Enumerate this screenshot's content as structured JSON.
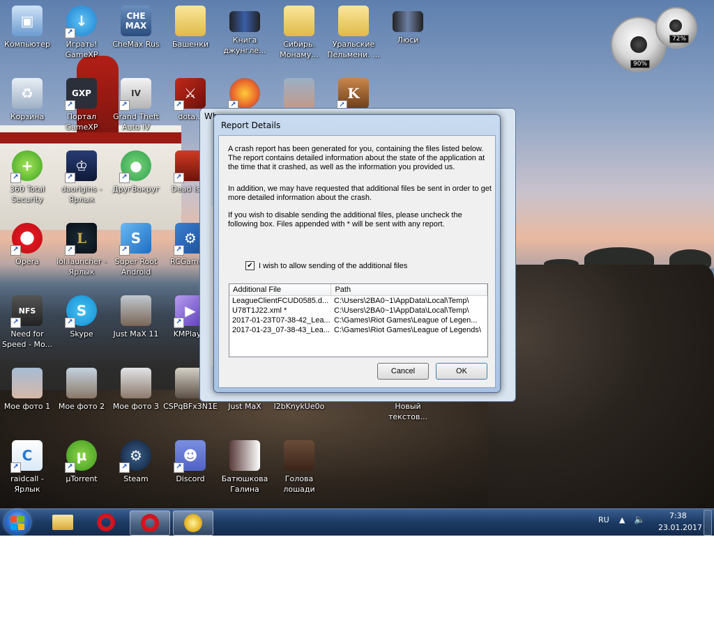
{
  "desktop": {
    "icons": [
      {
        "label": "Компьютер"
      },
      {
        "label": "Играть! GameXP"
      },
      {
        "label": "CheMax Rus"
      },
      {
        "label": "Башенки"
      },
      {
        "label": "Книга джунгле..."
      },
      {
        "label": "Сибирь. Монаму..."
      },
      {
        "label": "Уральские Пельмени. ..."
      },
      {
        "label": "Люси"
      },
      {
        "label": "Корзина"
      },
      {
        "label": "Портал GameXP"
      },
      {
        "label": "Grand Theft Auto IV"
      },
      {
        "label": "dota..."
      },
      {
        "label": "360 Total Security"
      },
      {
        "label": "daorigins - Ярлык"
      },
      {
        "label": "ДругВокруг"
      },
      {
        "label": "Dead Isl..."
      },
      {
        "label": "Opera"
      },
      {
        "label": "lol.launcher - Ярлык"
      },
      {
        "label": "Super Root Android"
      },
      {
        "label": "RCGame..."
      },
      {
        "label": "Need for Speed - Mo..."
      },
      {
        "label": "Skype"
      },
      {
        "label": "Just MaX 11"
      },
      {
        "label": "KMPlay..."
      },
      {
        "label": "Мое фото 1"
      },
      {
        "label": "Мое фото 2"
      },
      {
        "label": "Мое фото 3"
      },
      {
        "label": "CSPqBFx3N1E"
      },
      {
        "label": "Just MaX"
      },
      {
        "label": "l2bKnykUe0o"
      },
      {
        "label": "Новый текстов..."
      },
      {
        "label": "raidcall - Ярлык"
      },
      {
        "label": "µTorrent"
      },
      {
        "label": "Steam"
      },
      {
        "label": "Discord"
      },
      {
        "label": "Батюшкова Галина"
      },
      {
        "label": "Голова лошади"
      }
    ]
  },
  "gadget": {
    "cpu": "90%",
    "memory": "72%"
  },
  "background_window": {
    "title": "Wh..."
  },
  "dialog": {
    "title": "Report Details",
    "paragraph1": "A crash report has been generated for you, containing the files listed below. The report contains detailed information about the state of the application at the time that it crashed, as well as the information you provided us.",
    "paragraph2": "In addition, we may have requested that additional files be sent in order to get more detailed information about the crash.",
    "paragraph3": "If you wish to disable sending the additional files, please uncheck the following box.  Files appended with * will be sent with any report.",
    "checkbox_label": "I wish to allow sending of the additional files",
    "checkbox_checked": true,
    "columns": [
      "Additional File",
      "Path"
    ],
    "rows": [
      {
        "file": "LeagueClientFCUD0585.d...",
        "path": "C:\\Users\\2BA0~1\\AppData\\Local\\Temp\\"
      },
      {
        "file": "U78T1J22.xml *",
        "path": "C:\\Users\\2BA0~1\\AppData\\Local\\Temp\\"
      },
      {
        "file": "2017-01-23T07-38-42_Lea...",
        "path": "C:\\Games\\Riot Games\\League of Legen..."
      },
      {
        "file": "2017-01-23_07-38-43_Lea...",
        "path": "C:\\Games\\Riot Games\\League of Legends\\"
      }
    ],
    "cancel_label": "Cancel",
    "ok_label": "OK"
  },
  "taskbar": {
    "language": "RU",
    "time": "7:38",
    "date": "23.01.2017"
  }
}
